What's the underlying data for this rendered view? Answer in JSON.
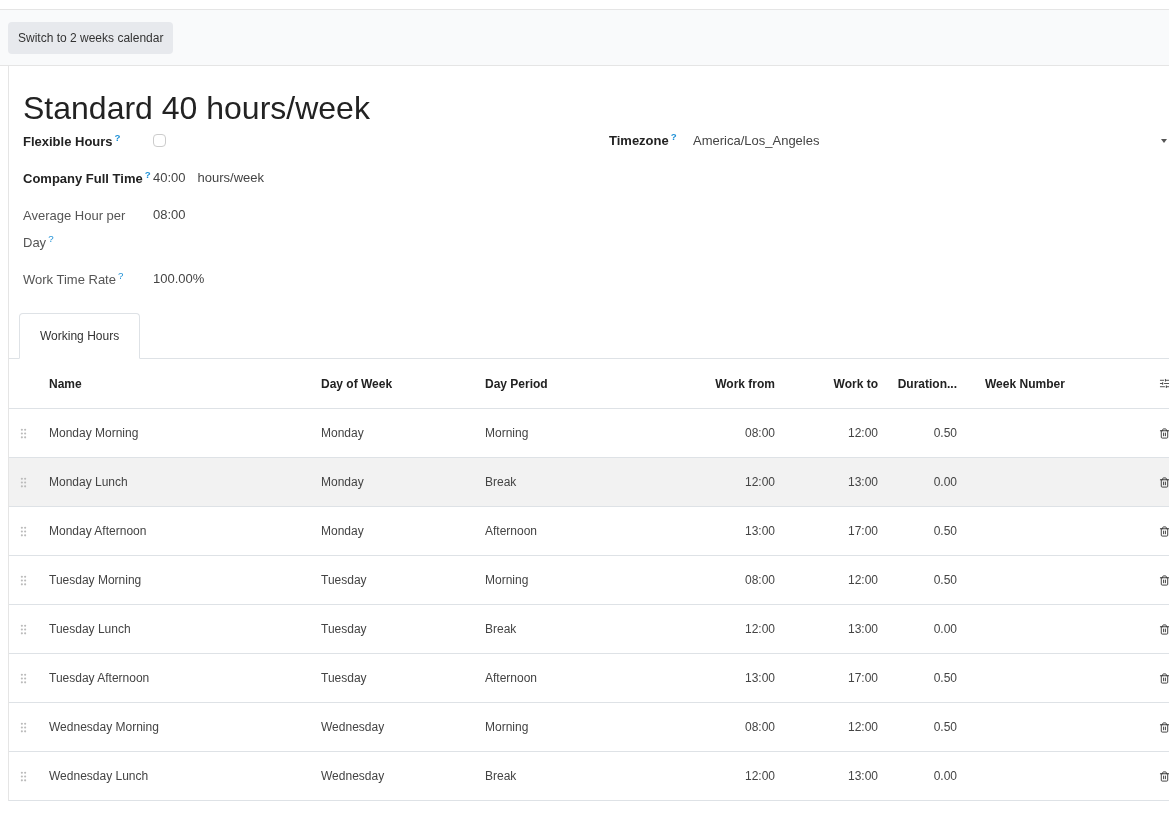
{
  "toolbar": {
    "button": "Switch to 2 weeks calendar"
  },
  "title": "Standard 40 hours/week",
  "fields_left": [
    {
      "label": "Flexible Hours",
      "help": "?",
      "required": true,
      "kind": "checkbox",
      "checked": false
    },
    {
      "label": "Company Full Time",
      "help": "?",
      "required": true,
      "kind": "text",
      "value": "40:00",
      "unit": "hours/week"
    },
    {
      "label": "Average Hour per Day",
      "help": "?",
      "required": false,
      "kind": "text",
      "value": "08:00"
    },
    {
      "label": "Work Time Rate",
      "help": "?",
      "required": false,
      "kind": "text",
      "value": "100.00%"
    }
  ],
  "fields_right": [
    {
      "label": "Timezone",
      "help": "?",
      "required": true,
      "kind": "select",
      "value": "America/Los_Angeles"
    }
  ],
  "tabs": [
    {
      "label": "Working Hours",
      "selected": true
    }
  ],
  "table": {
    "columns": [
      "Name",
      "Day of Week",
      "Day Period",
      "Work from",
      "Work to",
      "Duration...",
      "Week Number"
    ],
    "rows": [
      {
        "cells": [
          "Monday Morning",
          "Monday",
          "Morning",
          "08:00",
          "12:00",
          "0.50",
          ""
        ],
        "highlighted": false
      },
      {
        "cells": [
          "Monday Lunch",
          "Monday",
          "Break",
          "12:00",
          "13:00",
          "0.00",
          ""
        ],
        "highlighted": true
      },
      {
        "cells": [
          "Monday Afternoon",
          "Monday",
          "Afternoon",
          "13:00",
          "17:00",
          "0.50",
          ""
        ],
        "highlighted": false
      },
      {
        "cells": [
          "Tuesday Morning",
          "Tuesday",
          "Morning",
          "08:00",
          "12:00",
          "0.50",
          ""
        ],
        "highlighted": false
      },
      {
        "cells": [
          "Tuesday Lunch",
          "Tuesday",
          "Break",
          "12:00",
          "13:00",
          "0.00",
          ""
        ],
        "highlighted": false
      },
      {
        "cells": [
          "Tuesday Afternoon",
          "Tuesday",
          "Afternoon",
          "13:00",
          "17:00",
          "0.50",
          ""
        ],
        "highlighted": false
      },
      {
        "cells": [
          "Wednesday Morning",
          "Wednesday",
          "Morning",
          "08:00",
          "12:00",
          "0.50",
          ""
        ],
        "highlighted": false
      },
      {
        "cells": [
          "Wednesday Lunch",
          "Wednesday",
          "Break",
          "12:00",
          "13:00",
          "0.00",
          ""
        ],
        "highlighted": false
      }
    ]
  }
}
